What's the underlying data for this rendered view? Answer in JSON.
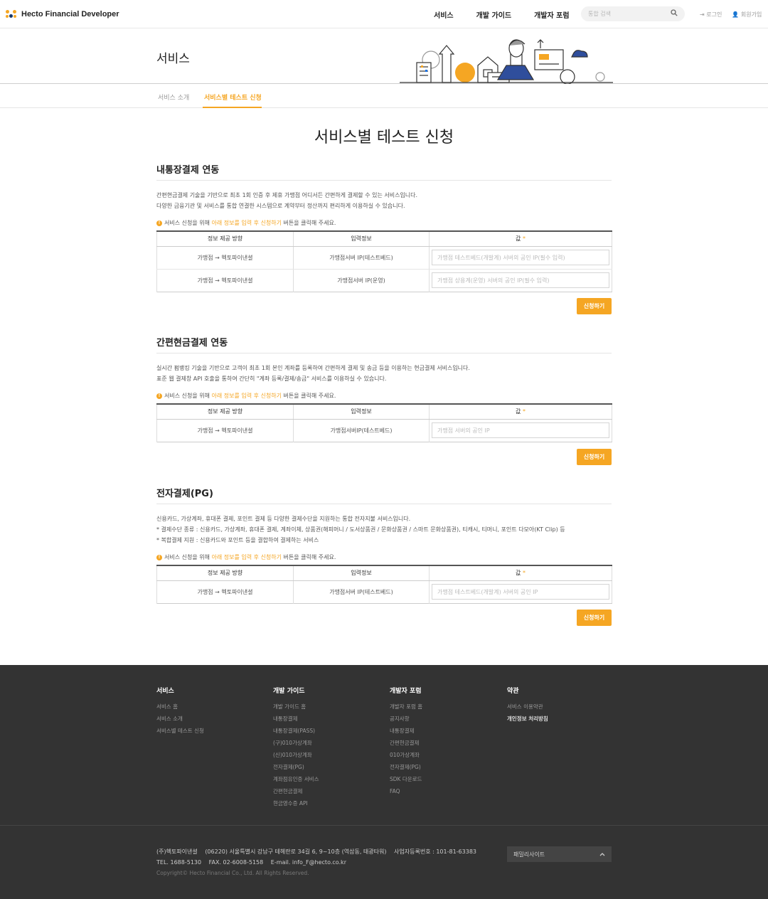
{
  "header": {
    "logo_text": "Hecto Financial Developer",
    "nav": [
      "서비스",
      "개발 가이드",
      "개발자 포럼"
    ],
    "search_placeholder": "통합 검색",
    "login": "로그인",
    "signup": "회원가입"
  },
  "banner": {
    "title": "서비스"
  },
  "subtabs": {
    "tab1": "서비스 소개",
    "tab2": "서비스별 테스트 신청"
  },
  "page_title": "서비스별 테스트 신청",
  "table_headers": {
    "col1": "정보 제공 방향",
    "col2": "입력정보",
    "col3": "값",
    "req": "*"
  },
  "notice": {
    "pre": "서비스 신청을 위해 ",
    "highlight": "아래 정보를 입력 후 신청하기",
    "post": " 버튼을 클릭해 주세요."
  },
  "apply_label": "신청하기",
  "sections": [
    {
      "title": "내통장결제 연동",
      "desc": [
        "간편현금결제 기술을 기반으로 최초 1회 인증 후 제휴 가맹점 어디서든 간편하게 결제할 수 있는 서비스입니다.",
        "다양한 금융기관 및 서비스를 통합 연결한 시스템으로 계약부터 정산까지 편리하게 이용하실 수 있습니다."
      ],
      "rows": [
        {
          "direction": "가맹점 → 헥토파이낸셜",
          "info": "가맹점서버 IP(테스트베드)",
          "placeholder": "가맹점 테스트베드(개발계) 서버의 공인 IP(필수 입력)"
        },
        {
          "direction": "가맹점 → 헥토파이낸셜",
          "info": "가맹점서버 IP(운영)",
          "placeholder": "가맹점 상용계(운영) 서버의 공인 IP(필수 입력)"
        }
      ]
    },
    {
      "title": "간편현금결제 연동",
      "desc": [
        "실시간 펌뱅킹 기술을 기반으로 고객이 최초 1회 본인 계좌를 등록하여 간편하게 결제 및 송금 등을 이용하는 현금결제 서비스입니다.",
        "표준 웹 결제창 API 호출을 통하여 간단히 \"계좌 등록/결제/송금\" 서비스를 이용하실 수 있습니다."
      ],
      "rows": [
        {
          "direction": "가맹점 → 헥토파이낸셜",
          "info": "가맹점서버IP(테스트베드)",
          "placeholder": "가맹점 서버의 공인 IP"
        }
      ]
    },
    {
      "title": "전자결제(PG)",
      "desc": [
        "신용카드, 가상계좌, 휴대폰 결제, 포인트 결제 등 다양한 결제수단을 지원하는 통합 전자지불 서비스입니다.",
        "* 결제수단 종류 : 신용카드, 가상계좌, 휴대폰 결제, 계좌이체, 상품권(해피머니 / 도서상품권 / 문화상품권 / 스마트 문화상품권), 티캐시, 티머니, 포인트 다모아(KT Clip) 등",
        "* 복합결제 지원 : 신용카드와 포인트 등을 결합하여 결제하는 서비스"
      ],
      "rows": [
        {
          "direction": "가맹점 → 헥토파이낸셜",
          "info": "가맹점서버 IP(테스트베드)",
          "placeholder": "가맹점 테스트베드(개발계) 서버의 공인 IP"
        }
      ]
    }
  ],
  "footer": {
    "cols": [
      {
        "title": "서비스",
        "items": [
          "서비스 홈",
          "서비스 소개",
          "서비스별 테스트 신청"
        ]
      },
      {
        "title": "개발 가이드",
        "items": [
          "개발 가이드 홈",
          "내통장결제",
          "내통장결제(PASS)",
          "(구)010가상계좌",
          "(신)010가상계좌",
          "전자결제(PG)",
          "계좌점유인증 서비스",
          "간편현금결제",
          "현금영수증 API"
        ]
      },
      {
        "title": "개발자 포럼",
        "items": [
          "개발자 포럼 홈",
          "공지사항",
          "내통장결제",
          "간편현금결제",
          "010가상계좌",
          "전자결제(PG)",
          "SDK 다운로드",
          "FAQ"
        ]
      },
      {
        "title": "약관",
        "items": [
          "서비스 이용약관",
          "개인정보 처리방침"
        ]
      }
    ],
    "company": "(주)헥토파이낸셜",
    "address": "(06220) 서울특별시 강남구 테헤란로 34길 6, 9~10층 (역삼동, 태광타워)",
    "bizno": "사업자등록번호 : 101-81-63383",
    "tel": "TEL. 1688-5130",
    "fax": "FAX. 02-6008-5158",
    "email": "E-mail. info_F@hecto.co.kr",
    "copyright": "Copyright© Hecto Financial Co., Ltd. All Rights Reserved.",
    "family_site": "패밀리사이트"
  },
  "colors": {
    "accent": "#f5a623",
    "footer_bg": "#333333"
  },
  "icons": [
    "logo-dots-icon",
    "search-icon",
    "login-icon",
    "signup-icon",
    "info-icon",
    "chevron-up-icon"
  ]
}
